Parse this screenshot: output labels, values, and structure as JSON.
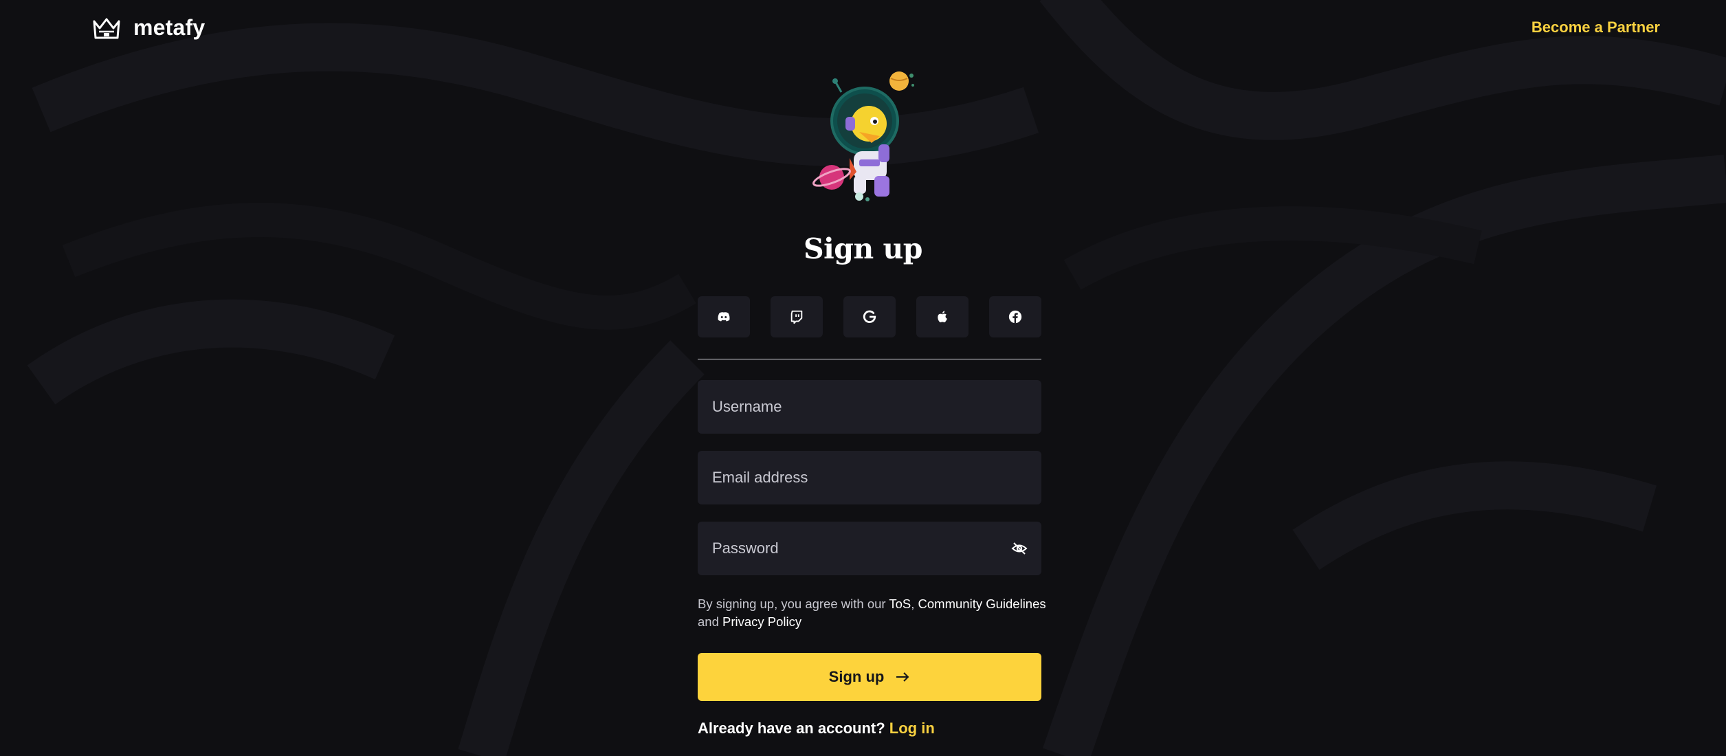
{
  "header": {
    "brand": "metafy",
    "partner_link": "Become a Partner"
  },
  "page": {
    "title": "Sign up"
  },
  "socials": [
    {
      "name": "discord"
    },
    {
      "name": "twitch"
    },
    {
      "name": "google"
    },
    {
      "name": "apple"
    },
    {
      "name": "facebook"
    }
  ],
  "form": {
    "username_placeholder": "Username",
    "email_placeholder": "Email address",
    "password_placeholder": "Password"
  },
  "terms": {
    "prefix": "By signing up, you agree with our ",
    "tos": "ToS",
    "comma": ", ",
    "guidelines": "Community Guidelines",
    "and": "and ",
    "privacy": "Privacy Policy"
  },
  "submit_label": "Sign up",
  "login": {
    "prompt": "Already have an account?",
    "link": "Log in"
  },
  "colors": {
    "background": "#0f0f12",
    "accent": "#fdd33c",
    "input_bg": "#1d1d25"
  }
}
